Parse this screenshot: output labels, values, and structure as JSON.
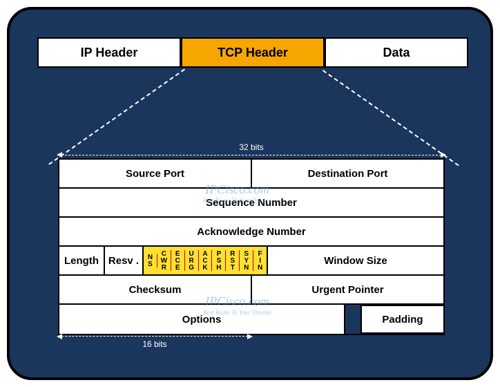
{
  "packet": {
    "ip": "IP Header",
    "tcp": "TCP Header",
    "data": "Data"
  },
  "width_top": "32 bits",
  "width_bottom": "16 bits",
  "rows": {
    "source_port": "Source Port",
    "dest_port": "Destination Port",
    "seq": "Sequence Number",
    "ack": "Acknowledge Number",
    "length": "Length",
    "resv": "Resv .",
    "window": "Window Size",
    "checksum": "Checksum",
    "urgent": "Urgent Pointer",
    "options": "Options",
    "padding": "Padding"
  },
  "flags": [
    "NS",
    "CWR",
    "ECE",
    "URG",
    "ACK",
    "PSH",
    "RST",
    "SYN",
    "FIN"
  ],
  "watermark": {
    "main": "IPCisco.com",
    "sub": "Best Route To Your Dreams"
  }
}
